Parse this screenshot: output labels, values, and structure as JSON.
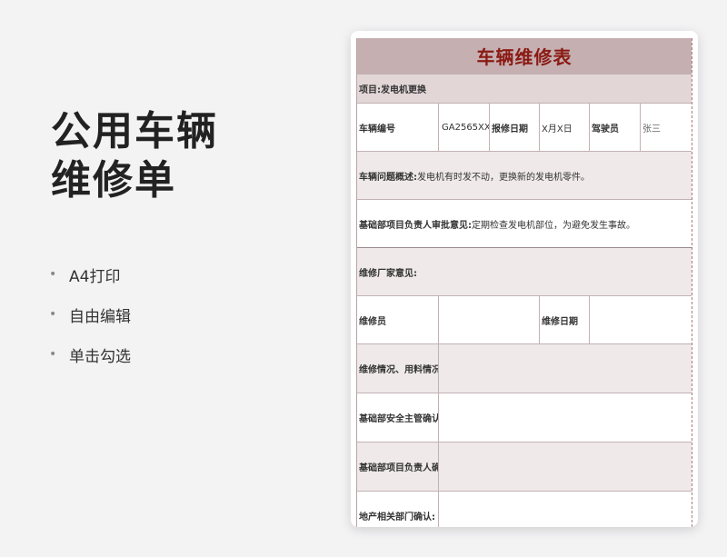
{
  "promo": {
    "title_line1": "公用车辆",
    "title_line2": "维修单",
    "features": [
      "A4打印",
      "自由编辑",
      "单击勾选"
    ]
  },
  "form": {
    "title": "车辆维修表",
    "project": "项目:发电机更换",
    "vehicle_no_label": "车辆编号",
    "vehicle_no": "GA2565XXX",
    "report_date_label": "报修日期",
    "report_date": "X月X日",
    "driver_label": "驾驶员",
    "driver": "张三",
    "issue_label": "车辆问题概述:",
    "issue_text": "发电机有时发不动，更换新的发电机零件。",
    "approval_label": "基础部项目负责人审批意见:",
    "approval_text": "定期检查发电机部位，为避免发生事故。",
    "vendor_opinion_label": "维修厂家意见:",
    "repairer_label": "维修员",
    "repair_date_label": "维修日期",
    "repair_status_label": "维修情况、用料情况:",
    "safety_label": "基础部安全主管确认:",
    "pm_confirm_label": "基础部项目负责人确认:",
    "estate_label": "地产相关部门确认:"
  }
}
